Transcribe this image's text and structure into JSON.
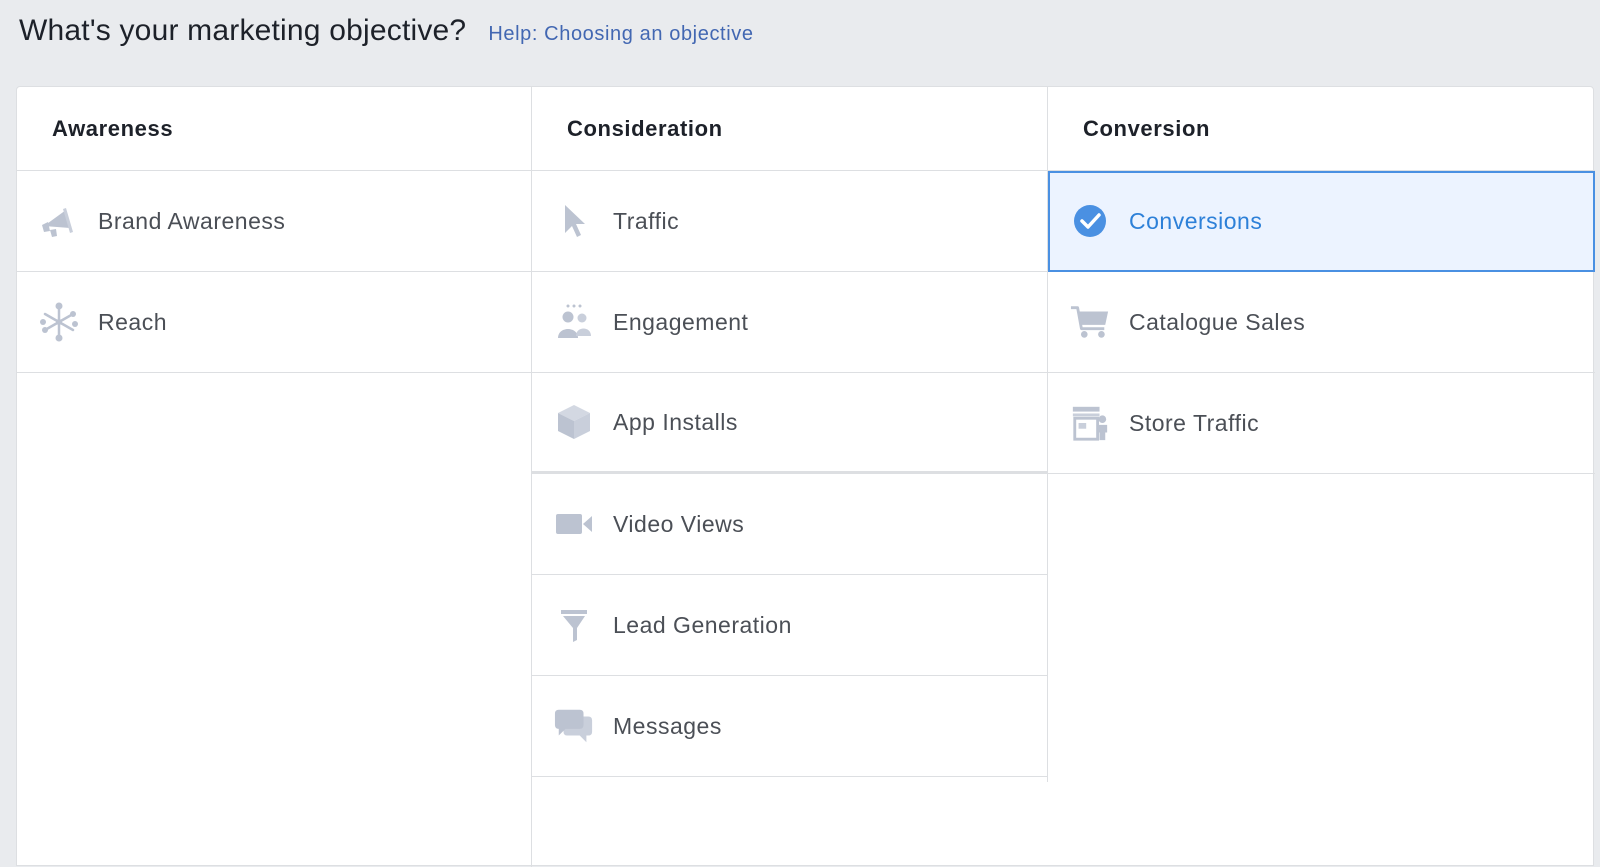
{
  "header": {
    "title": "What's your marketing objective?",
    "help_link": "Help: Choosing an objective"
  },
  "columns": [
    {
      "heading": "Awareness",
      "items": [
        {
          "label": "Brand Awareness",
          "icon": "megaphone-icon"
        },
        {
          "label": "Reach",
          "icon": "reach-icon"
        }
      ]
    },
    {
      "heading": "Consideration",
      "items": [
        {
          "label": "Traffic",
          "icon": "cursor-icon"
        },
        {
          "label": "Engagement",
          "icon": "people-icon"
        },
        {
          "label": "App Installs",
          "icon": "box-icon"
        },
        {
          "label": "Video Views",
          "icon": "video-camera-icon"
        },
        {
          "label": "Lead Generation",
          "icon": "funnel-icon"
        },
        {
          "label": "Messages",
          "icon": "chat-bubbles-icon"
        }
      ]
    },
    {
      "heading": "Conversion",
      "items": [
        {
          "label": "Conversions",
          "icon": "check-circle-icon",
          "selected": true
        },
        {
          "label": "Catalogue Sales",
          "icon": "shopping-cart-icon"
        },
        {
          "label": "Store Traffic",
          "icon": "store-icon"
        }
      ]
    }
  ],
  "colors": {
    "icon_gray": "#bcc3d1",
    "selected_blue": "#4a90e2",
    "link_blue": "#4267b2"
  }
}
